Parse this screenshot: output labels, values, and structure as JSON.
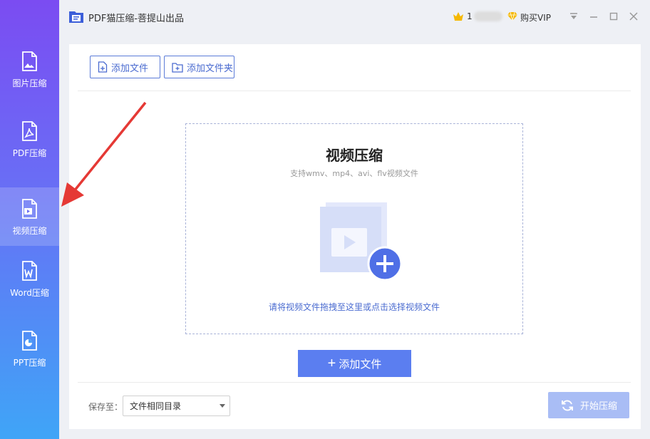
{
  "app": {
    "title": "PDF猫压缩-菩提山出品"
  },
  "user": {
    "name": "1",
    "vip_label": "购买VIP"
  },
  "sidebar": {
    "items": [
      {
        "label": "图片压缩",
        "icon": "image-file-icon",
        "active": false
      },
      {
        "label": "PDF压缩",
        "icon": "pdf-file-icon",
        "active": false
      },
      {
        "label": "视频压缩",
        "icon": "video-file-icon",
        "active": true
      },
      {
        "label": "Word压缩",
        "icon": "word-file-icon",
        "active": false
      },
      {
        "label": "PPT压缩",
        "icon": "ppt-file-icon",
        "active": false
      }
    ]
  },
  "toolbar": {
    "add_file_label": "添加文件",
    "add_folder_label": "添加文件夹"
  },
  "dropzone": {
    "title": "视频压缩",
    "subtitle": "支持wmv、mp4、avi、flv视频文件",
    "hint": "请将视频文件拖拽至这里或点击选择视频文件"
  },
  "add_button": {
    "label": "添加文件"
  },
  "footer": {
    "save_label": "保存至：",
    "save_option": "文件相同目录",
    "start_label": "开始压缩"
  },
  "colors": {
    "accent": "#5b7ef0",
    "sidebar_top": "#7b4cf2",
    "sidebar_bottom": "#3fa5f7",
    "annotation": "#e53935"
  }
}
